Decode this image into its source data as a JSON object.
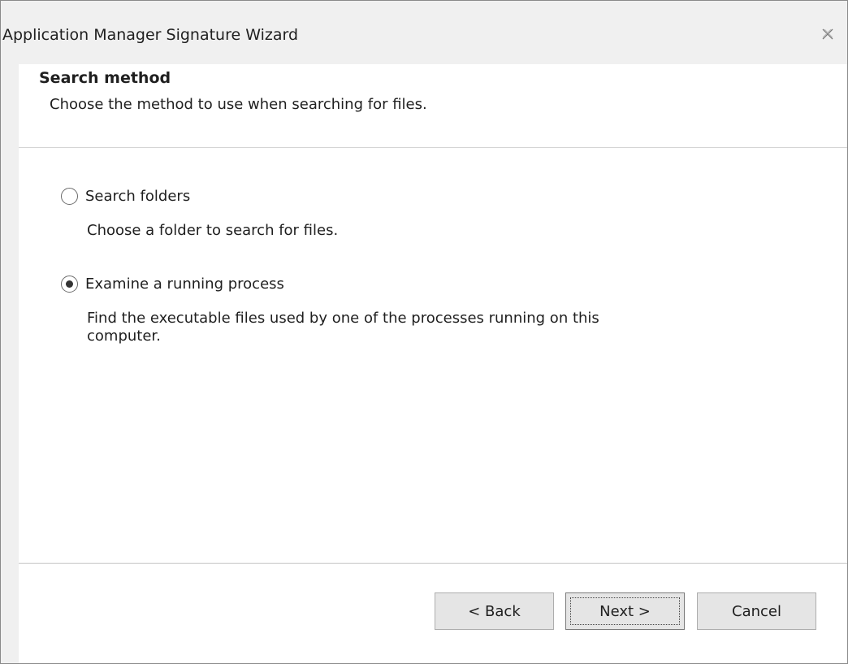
{
  "window": {
    "title": "Application Manager Signature Wizard",
    "close_icon": "close-icon"
  },
  "header": {
    "title": "Search method",
    "description": "Choose the method to use when searching for files."
  },
  "options": [
    {
      "label": "Search folders",
      "description": "Choose a folder to search for files.",
      "checked": false
    },
    {
      "label": "Examine a running process",
      "description": "Find the executable files used by one of the processes running on this computer.",
      "checked": true
    }
  ],
  "footer": {
    "back_label": "< Back",
    "next_label": "Next >",
    "cancel_label": "Cancel"
  }
}
